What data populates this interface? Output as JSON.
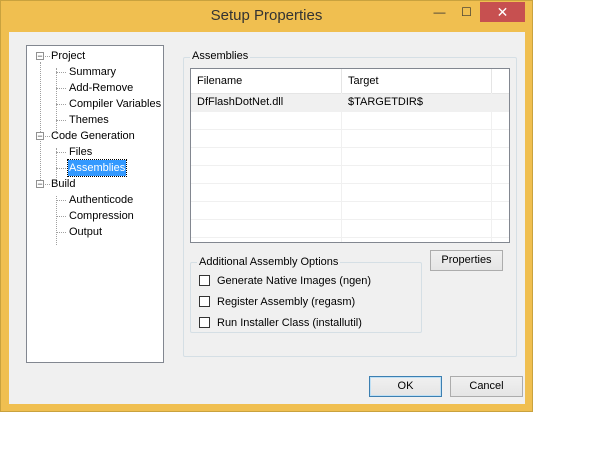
{
  "window": {
    "title": "Setup Properties"
  },
  "titlebar": {
    "minimize_glyph": "—",
    "maximize_glyph": "☐",
    "close_glyph": "✕"
  },
  "tree": {
    "nodes": [
      {
        "label": "Project",
        "children": [
          "Summary",
          "Add-Remove",
          "Compiler Variables",
          "Themes"
        ]
      },
      {
        "label": "Code Generation",
        "children": [
          "Files",
          "Assemblies"
        ]
      },
      {
        "label": "Build",
        "children": [
          "Authenticode",
          "Compression",
          "Output"
        ]
      }
    ],
    "selected": "Assemblies",
    "toggle_glyph": "−"
  },
  "assemblies": {
    "group_label": "Assemblies",
    "columns": [
      "Filename",
      "Target"
    ],
    "rows": [
      {
        "filename": "DfFlashDotNet.dll",
        "target": "$TARGETDIR$"
      }
    ]
  },
  "options": {
    "group_label": "Additional Assembly Options",
    "items": [
      {
        "label": "Generate Native Images (ngen)",
        "checked": false
      },
      {
        "label": "Register Assembly (regasm)",
        "checked": false
      },
      {
        "label": "Run Installer Class (installutil)",
        "checked": false
      }
    ]
  },
  "buttons": {
    "properties": "Properties",
    "ok": "OK",
    "cancel": "Cancel"
  },
  "colors": {
    "frame": "#f0bf50",
    "close": "#c75050",
    "selection": "#3399ff"
  }
}
